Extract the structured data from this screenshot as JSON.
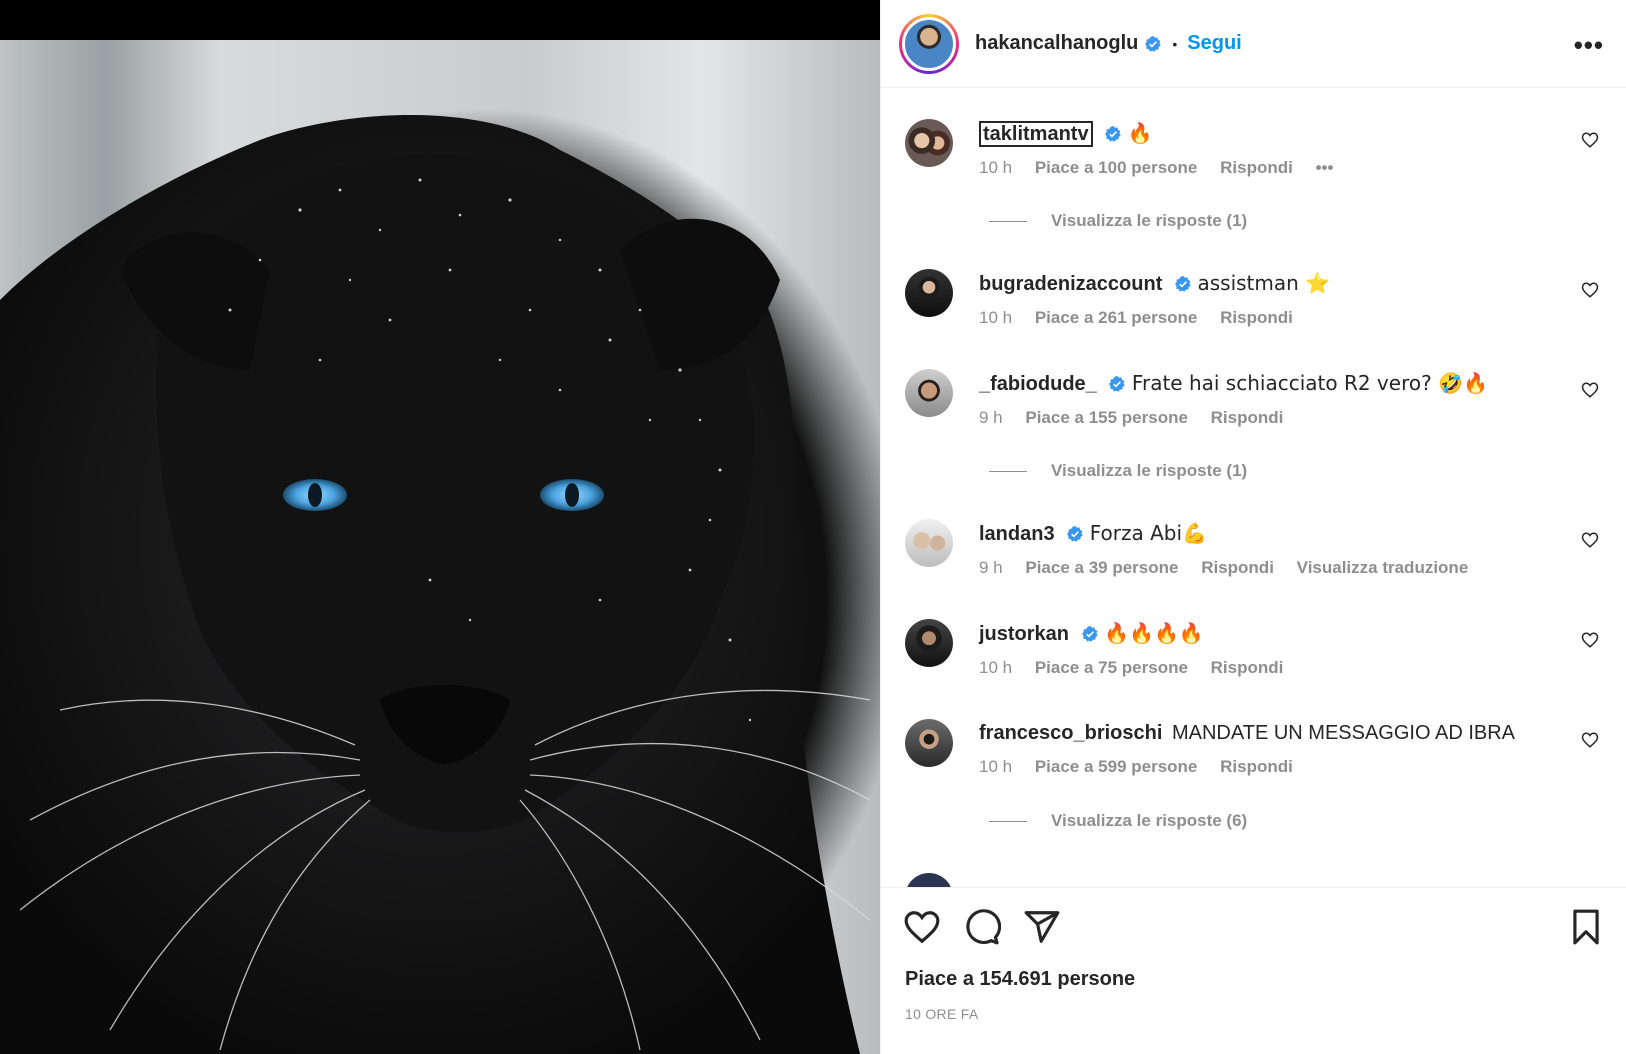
{
  "post": {
    "author": "hakancalhanoglu",
    "follow_label": "Segui",
    "separator": "•",
    "more_label": "•••",
    "likes_text": "Piace a 154.691 persone",
    "time_text": "10 ORE FA"
  },
  "comments": [
    {
      "user": "taklitmantv",
      "text": "🔥",
      "time": "10 h",
      "likes": "Piace a 100 persone",
      "reply": "Rispondi",
      "extra": "•••",
      "replies": "Visualizza le risposte (1)"
    },
    {
      "user": "bugradenizaccount",
      "text": "assistman ⭐",
      "time": "10 h",
      "likes": "Piace a 261 persone",
      "reply": "Rispondi"
    },
    {
      "user": "_fabiodude_",
      "text": "Frate hai schiacciato R2 vero? 🤣🔥",
      "time": "9 h",
      "likes": "Piace a 155 persone",
      "reply": "Rispondi",
      "replies": "Visualizza le risposte (1)"
    },
    {
      "user": "landan3",
      "text": "Forza Abi💪",
      "time": "9 h",
      "likes": "Piace a 39 persone",
      "reply": "Rispondi",
      "translate": "Visualizza traduzione"
    },
    {
      "user": "justorkan",
      "text": "🔥🔥🔥🔥",
      "time": "10 h",
      "likes": "Piace a 75 persone",
      "reply": "Rispondi"
    },
    {
      "user": "francesco_brioschi",
      "text": "MANDATE UN MESSAGGIO AD IBRA",
      "time": "10 h",
      "likes": "Piace a 599 persone",
      "reply": "Rispondi",
      "replies": "Visualizza le risposte (6)"
    }
  ],
  "colors": {
    "accent": "#0095f6",
    "verified": "#3897f0",
    "text": "#262626",
    "muted": "#8e8e8e"
  },
  "icons": [
    "verified-badge-icon",
    "heart-icon",
    "comment-icon",
    "share-icon",
    "bookmark-icon",
    "more-icon"
  ]
}
